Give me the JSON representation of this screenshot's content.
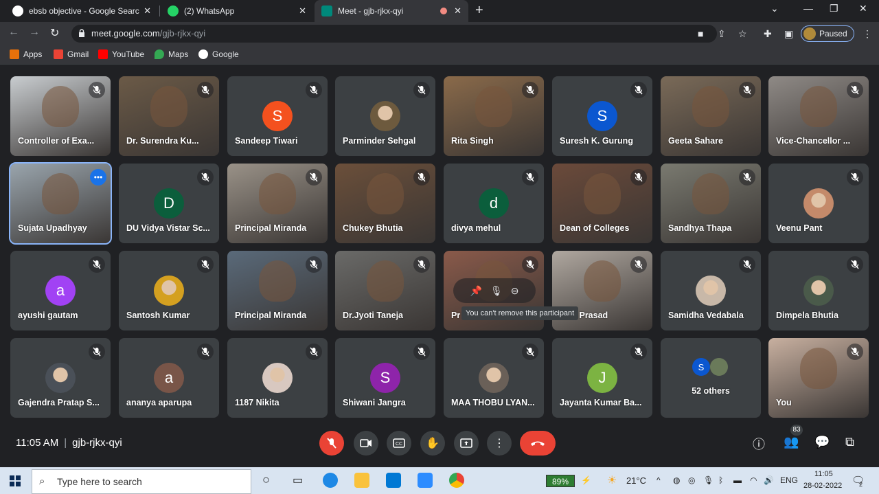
{
  "browser": {
    "tabs": [
      {
        "title": "ebsb objective - Google Search",
        "fav_color": "#ffffff"
      },
      {
        "title": "(2) WhatsApp",
        "fav_color": "#25d366"
      },
      {
        "title": "Meet - gjb-rjkx-qyi",
        "fav_color": "#00897b"
      }
    ],
    "url_host": "meet.google.com",
    "url_path": "/gjb-rjkx-qyi",
    "profile_status": "Paused",
    "bookmarks": [
      "Apps",
      "Gmail",
      "YouTube",
      "Maps",
      "Google"
    ]
  },
  "meet": {
    "participants": [
      {
        "name": "Controller of Exa...",
        "kind": "video",
        "bg": "#c9cdd0"
      },
      {
        "name": "Dr. Surendra Ku...",
        "kind": "video",
        "bg": "#6b5a47"
      },
      {
        "name": "Sandeep Tiwari",
        "kind": "avatar",
        "letter": "S",
        "color": "#f4511e"
      },
      {
        "name": "Parminder Sehgal",
        "kind": "photo",
        "color": "#6d5a3e"
      },
      {
        "name": "Rita Singh",
        "kind": "video",
        "bg": "#8a6a4a"
      },
      {
        "name": "Suresh K. Gurung",
        "kind": "avatar",
        "letter": "S",
        "color": "#0b57d0"
      },
      {
        "name": "Geeta Sahare",
        "kind": "video",
        "bg": "#7a6a58"
      },
      {
        "name": "Vice-Chancellor ...",
        "kind": "video",
        "bg": "#8f8a86"
      },
      {
        "name": "Sujata Upadhyay",
        "kind": "video",
        "bg": "#9aa5ad",
        "active": true
      },
      {
        "name": "DU Vidya Vistar Sc...",
        "kind": "avatar",
        "letter": "D",
        "color": "#0b5e3c"
      },
      {
        "name": "Principal Miranda",
        "kind": "video",
        "bg": "#9a9288"
      },
      {
        "name": "Chukey Bhutia",
        "kind": "video",
        "bg": "#6b4f3a"
      },
      {
        "name": "divya mehul",
        "kind": "avatar",
        "letter": "d",
        "color": "#0b5e3c"
      },
      {
        "name": "Dean of Colleges",
        "kind": "video",
        "bg": "#6b4a3a"
      },
      {
        "name": "Sandhya Thapa",
        "kind": "video",
        "bg": "#7a7a70"
      },
      {
        "name": "Veenu Pant",
        "kind": "photo",
        "color": "#c48a6a"
      },
      {
        "name": "ayushi gautam",
        "kind": "avatar",
        "letter": "a",
        "color": "#a142f4"
      },
      {
        "name": "Santosh Kumar",
        "kind": "photo",
        "color": "#d4a020"
      },
      {
        "name": "Principal Miranda",
        "kind": "video",
        "bg": "#5a6a7a"
      },
      {
        "name": "Dr.Jyoti Taneja",
        "kind": "video",
        "bg": "#6a6a68"
      },
      {
        "name": "Pr",
        "kind": "video",
        "bg": "#8a5a4a"
      },
      {
        "name": "nika Prasad",
        "kind": "video",
        "bg": "#b0a8a0"
      },
      {
        "name": "Samidha Vedabala",
        "kind": "photo",
        "color": "#c8b8a8"
      },
      {
        "name": "Dimpela Bhutia",
        "kind": "photo",
        "color": "#4a5a4a"
      },
      {
        "name": "Gajendra Pratap S...",
        "kind": "photo",
        "color": "#4a5058"
      },
      {
        "name": "ananya aparupa",
        "kind": "avatar",
        "letter": "a",
        "color": "#795548"
      },
      {
        "name": "1187 Nikita",
        "kind": "photo",
        "color": "#d8c8c0"
      },
      {
        "name": "Shiwani Jangra",
        "kind": "avatar",
        "letter": "S",
        "color": "#8e24aa"
      },
      {
        "name": "MAA THOBU LYAN...",
        "kind": "photo",
        "color": "#6a6058"
      },
      {
        "name": "Jayanta Kumar Ba...",
        "kind": "avatar",
        "letter": "J",
        "color": "#7cb342"
      },
      {
        "name": "52 others",
        "kind": "others"
      },
      {
        "name": "You",
        "kind": "video",
        "bg": "#c8b0a0"
      }
    ],
    "others_letter": "S",
    "tooltip": "You can't remove this participant",
    "time": "11:05 AM",
    "meeting_code": "gjb-rjkx-qyi",
    "participant_count": "83"
  },
  "taskbar": {
    "search_placeholder": "Type here to search",
    "battery": "89%",
    "weather": "21°C",
    "lang": "ENG",
    "time": "11:05",
    "date": "28-02-2022",
    "notif_count": "2"
  }
}
